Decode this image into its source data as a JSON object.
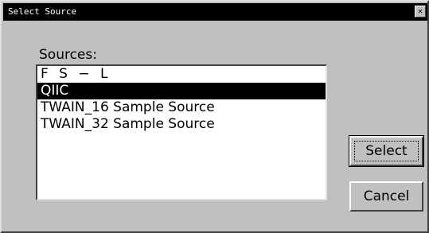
{
  "window": {
    "title": "Select Source",
    "close_glyph": "✕"
  },
  "colors": {
    "titlebar": "#000000",
    "face": "#c0c0c0",
    "selection": "#000000"
  },
  "sources": {
    "label": "Sources:",
    "items": [
      {
        "label": "F S − L",
        "selected": false
      },
      {
        "label": "QIIC",
        "selected": true
      },
      {
        "label": "TWAIN_16 Sample Source",
        "selected": false
      },
      {
        "label": "TWAIN_32 Sample Source",
        "selected": false
      }
    ]
  },
  "buttons": {
    "select_label": "Select",
    "cancel_label": "Cancel"
  }
}
